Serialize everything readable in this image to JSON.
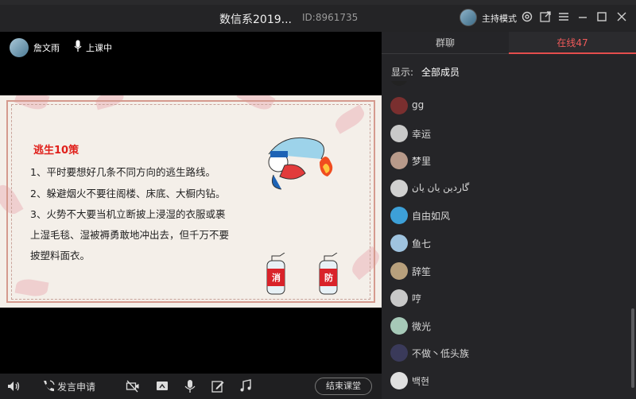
{
  "top_tabs": [
    "...",
    "...",
    "...",
    "...",
    "...",
    "...",
    "...",
    "..."
  ],
  "window": {
    "title": "数信系2019...",
    "room_id": "ID:8961735",
    "host_mode_label": "主持模式"
  },
  "video": {
    "teacher_name": "詹文雨",
    "status": "上课中"
  },
  "slide": {
    "title": "逃生10策",
    "lines": [
      "1、平时要想好几条不同方向的逃生路线。",
      "2、躲避烟火不要往阁楼、床底、大橱内钻。",
      "3、火势不大要当机立断披上浸湿的衣服或裹",
      "上湿毛毯、湿被褥勇敢地冲出去，但千万不要",
      "披塑料面衣。"
    ],
    "extinguisher_labels": [
      "消",
      "防"
    ]
  },
  "bottombar": {
    "speak_request": "发言申请",
    "end_class": "结束课堂"
  },
  "panel": {
    "tabs": [
      {
        "label": "群聊",
        "active": false
      },
      {
        "label": "在线47",
        "active": true
      }
    ],
    "filter_label": "显示:",
    "filter_value": "全部成员",
    "members": [
      {
        "name": "gg",
        "color": "#7a2f2f"
      },
      {
        "name": "幸运",
        "color": "#c9c9c9"
      },
      {
        "name": "梦里",
        "color": "#b89a8a"
      },
      {
        "name": "گاردین یان یان",
        "color": "#d0d0d0"
      },
      {
        "name": "自由如风",
        "color": "#3da0d8"
      },
      {
        "name": "鱼七",
        "color": "#9fc3df"
      },
      {
        "name": "辞笙",
        "color": "#b8a07c"
      },
      {
        "name": "哼",
        "color": "#c8c8c8"
      },
      {
        "name": "微光",
        "color": "#a6c9b8"
      },
      {
        "name": "不做丶低头族",
        "color": "#3a3a5a"
      },
      {
        "name": "백현",
        "color": "#e0e0e0"
      }
    ]
  },
  "colors": {
    "accent": "#e44d4d",
    "slide_title": "#e0201b",
    "background": "#1b1b1d"
  }
}
